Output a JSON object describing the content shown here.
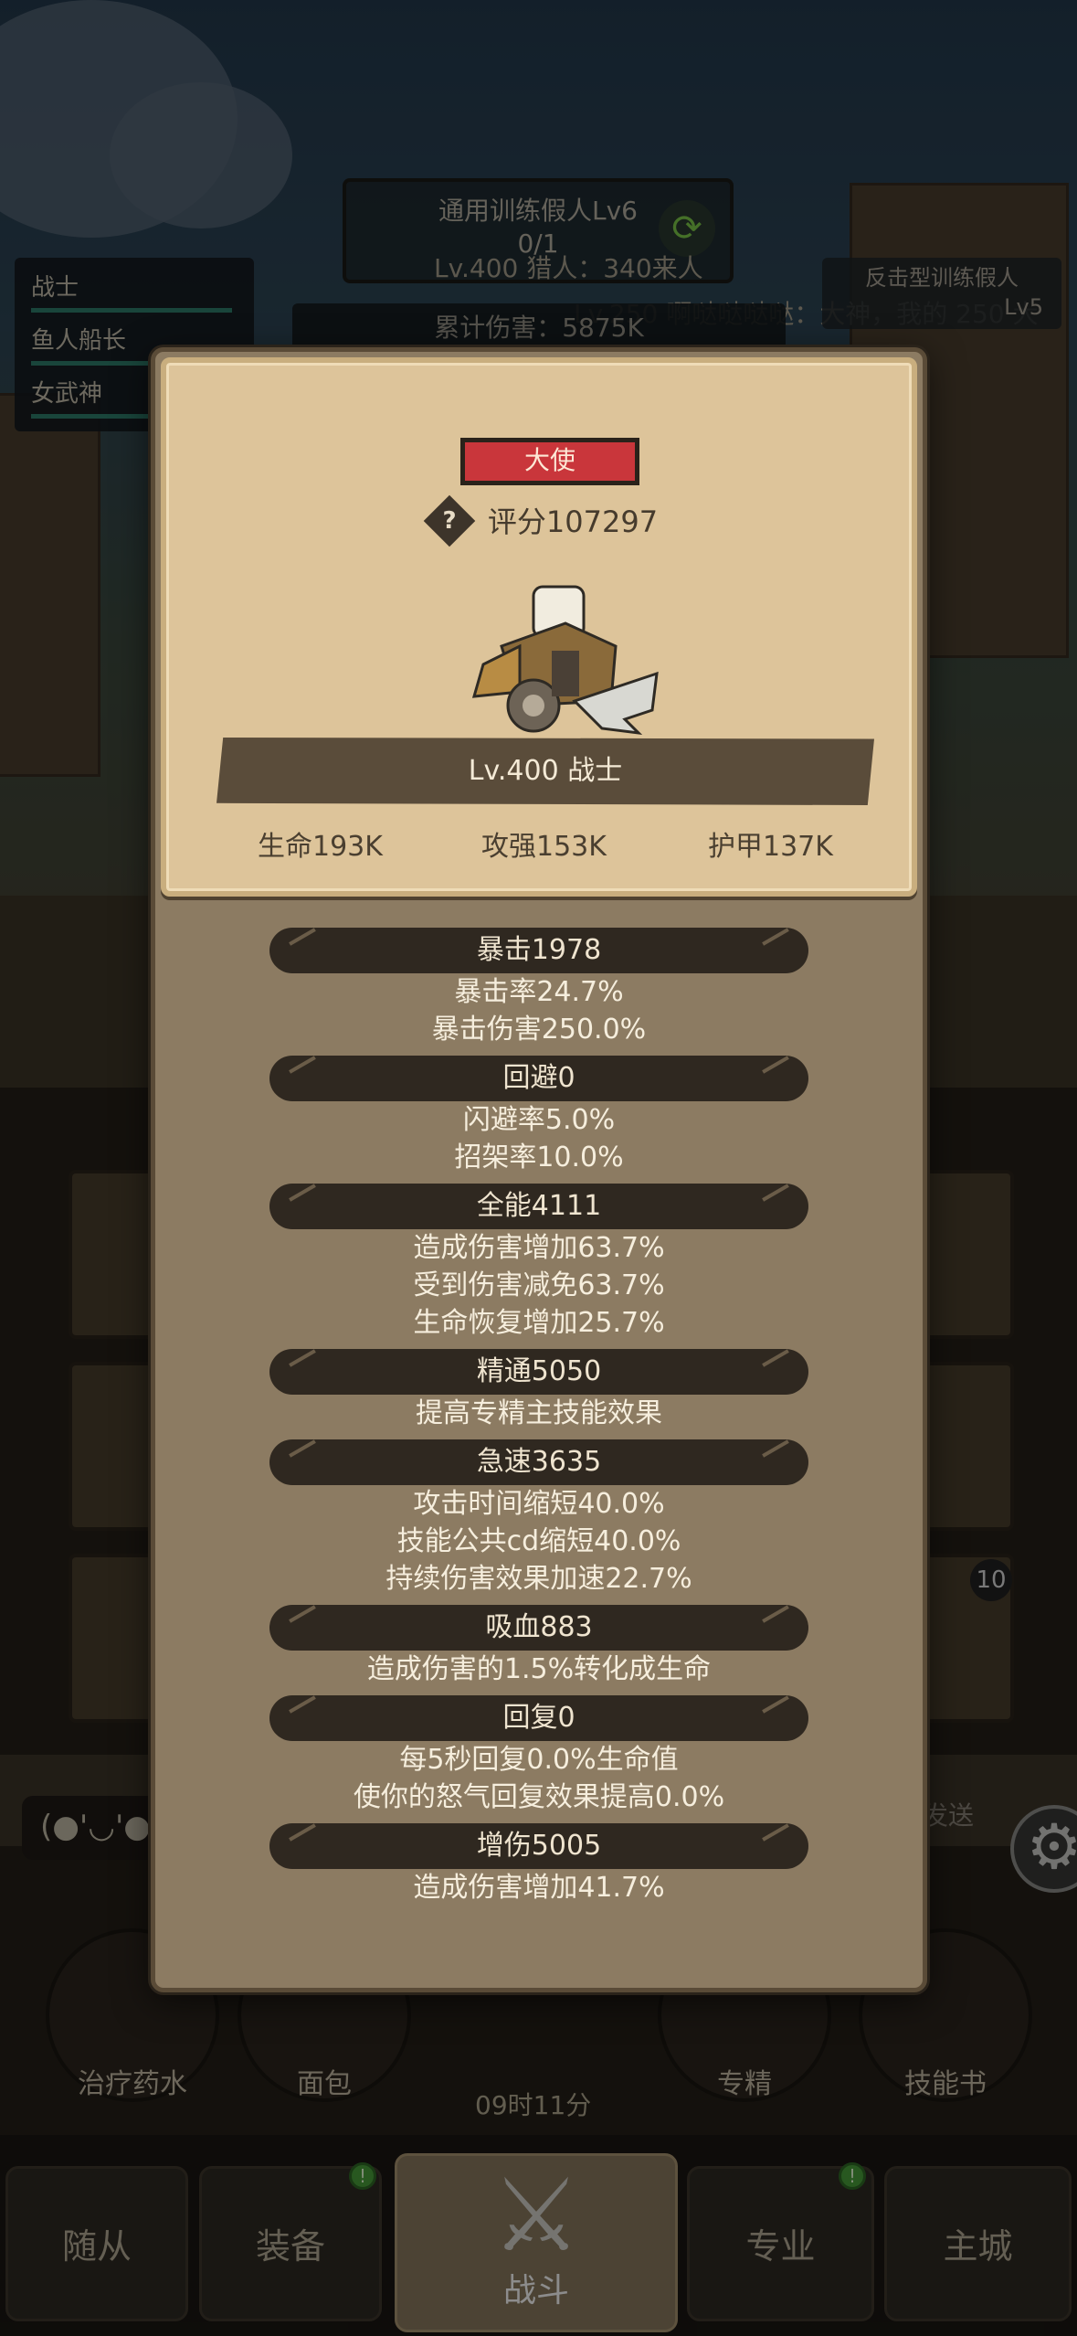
{
  "background": {
    "boss_title": "通用训练假人Lv6",
    "boss_progress": "0/1",
    "hunter_line": "Lv.400 猎人：340来人",
    "chat_scroll": "Lv.250 啊哒哒哒哒：大神，我的 250 大",
    "damage_total": "累计伤害：5875K",
    "team": [
      "战士",
      "鱼人船长",
      "女武神"
    ],
    "dummy_name": "反击型训练假人",
    "dummy_level": "Lv5",
    "slot_badge": "10"
  },
  "chat": {
    "emote_text": "(●'◡'●",
    "send_label": "发送"
  },
  "items": [
    {
      "label": "治疗药水"
    },
    {
      "label": "面包"
    },
    {
      "label": "专精"
    },
    {
      "label": "技能书"
    }
  ],
  "timer": "09时11分",
  "nav": {
    "followers": "随从",
    "equipment": "装备",
    "battle": "战斗",
    "profession": "专业",
    "main_city": "主城"
  },
  "hero_card": {
    "rank": "大使",
    "score": "评分107297",
    "level_title": "Lv.400 战士",
    "hp": "生命193K",
    "attack": "攻强153K",
    "armor": "护甲137K"
  },
  "sections": [
    {
      "header": "暴击1978",
      "lines": [
        "暴击率24.7%",
        "暴击伤害250.0%"
      ]
    },
    {
      "header": "回避0",
      "lines": [
        "闪避率5.0%",
        "招架率10.0%"
      ]
    },
    {
      "header": "全能4111",
      "lines": [
        "造成伤害增加63.7%",
        "受到伤害减免63.7%",
        "生命恢复增加25.7%"
      ]
    },
    {
      "header": "精通5050",
      "lines": [
        "提高专精主技能效果"
      ]
    },
    {
      "header": "急速3635",
      "lines": [
        "攻击时间缩短40.0%",
        "技能公共cd缩短40.0%",
        "持续伤害效果加速22.7%"
      ]
    },
    {
      "header": "吸血883",
      "lines": [
        "造成伤害的1.5%转化成生命"
      ]
    },
    {
      "header": "回复0",
      "lines": [
        "每5秒回复0.0%生命值",
        "使你的怒气回复效果提高0.0%"
      ]
    },
    {
      "header": "增伤5005",
      "lines": [
        "造成伤害增加41.7%"
      ]
    }
  ]
}
